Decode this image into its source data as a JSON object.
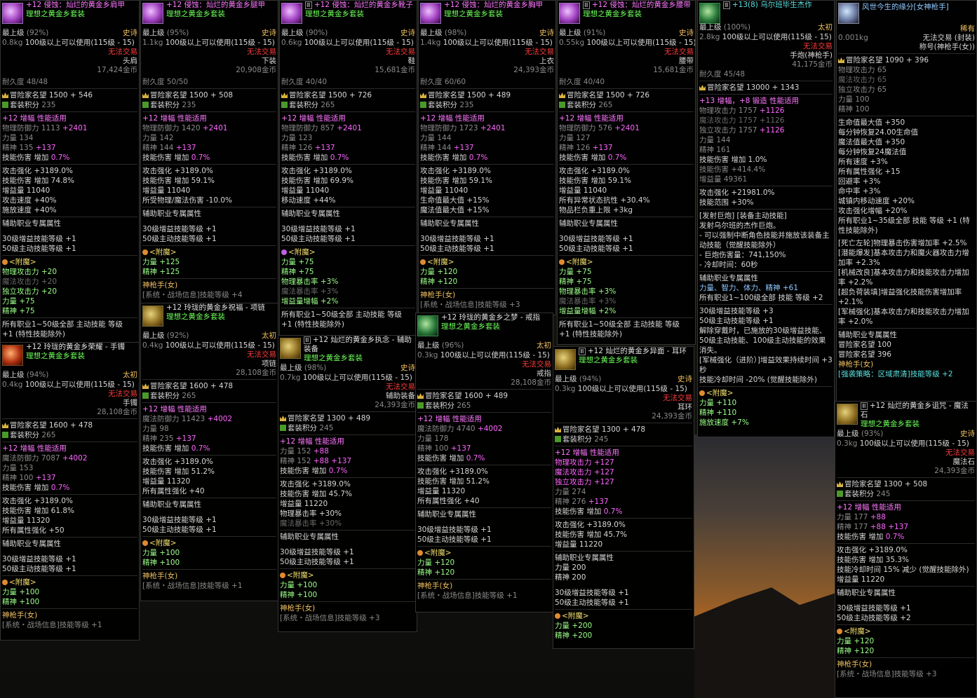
{
  "common": {
    "level_label": "最上级",
    "req_label": "100级以上可以使用(115级 - 15)",
    "no_trade": "无法交易",
    "set_name": "理想之黄金乡套装",
    "durability_prefix": "耐久度",
    "adv_prefix": "冒险家名望",
    "set_points_label": "套装积分",
    "perf_label": "增幅 性能适用",
    "aux_label": "辅助职业专属属性",
    "enchant_label": "<附魔>",
    "class": "神枪手(女)",
    "sys_line": "[系统・战场信息]技能等级",
    "lvl30": "30级增益技能等级 +1",
    "lvl50": "50级主动技能等级 +1",
    "skill_dmg": "技能伤害 增加",
    "atk_inc": "攻击强化 +3189.0%",
    "buff_label": "增益量"
  },
  "shoulder": {
    "title": "+12 侵蚀：灿烂的黄金乡肩甲",
    "grade_pct": "(92%)",
    "rarity": "史诗",
    "weight": "0.8kg",
    "slot": "头肩",
    "price": "17,424金币",
    "dura": "48/48",
    "adv": "1500 + 546",
    "set_pts": "235",
    "l1": "物理防御力 1113",
    "l1b": "+2401",
    "l2": "力量 134",
    "l3": "精神 135",
    "l3b": "+137",
    "l4b": "0.7%",
    "s1": "技能伤害 增加 74.8%",
    "s2": "增益量 11040",
    "s3": "攻击速度 +40%",
    "s4": "施放速度 +40%",
    "e1": "物理攻击力 +20",
    "e2": "魔法攻击力 +20",
    "e3": "独立攻击力 +20",
    "e4": "力量 +75",
    "e5": "精神 +75",
    "f1": "所有职业1~50级全部 主动技能 等级",
    "f2": "+1 (特性技能除外)"
  },
  "bracelet": {
    "title": "+12 玲珑的黄金乡荣耀 - 手镯",
    "grade_pct": "(94%)",
    "rarity": "太初",
    "weight": "0.4kg",
    "slot": "手镯",
    "price": "28,108金币",
    "adv": "1600 + 478",
    "set_pts": "265",
    "l1": "魔法防御力 7087",
    "l1b": "+4002",
    "l2": "力量 153",
    "l3": "精神 100",
    "l3b": "+137",
    "l4b": "0.7%",
    "s1": "技能伤害 增加 61.8%",
    "s2": "增益量 11320",
    "s3": "所有属性强化 +50",
    "e1": "力量 +100",
    "e2": "精神 +100",
    "sys": "+1"
  },
  "pants": {
    "title": "+12 侵蚀：灿烂的黄金乡腿甲",
    "grade_pct": "(95%)",
    "rarity": "史诗",
    "weight": "1.1kg",
    "slot": "下装",
    "price": "20,908金币",
    "dura": "50/50",
    "adv": "1500 + 508",
    "set_pts": "235",
    "l1": "物理防御力 1420",
    "l1b": "+2401",
    "l2": "力量 142",
    "l3": "精神 144",
    "l3b": "+137",
    "l4b": "0.7%",
    "s1": "技能伤害 增加 59.1%",
    "s2": "增益量 11040",
    "s3": "所受物理/魔法伤害 -10.0%",
    "e1": "力量 +125",
    "e2": "精神 +125",
    "sys": "+4"
  },
  "necklace": {
    "title": "+12 玲珑的黄金乡祝福 - 项链",
    "grade_pct": "(92%)",
    "rarity": "太初",
    "weight": "0.4kg",
    "slot": "项链",
    "price": "28,108金币",
    "adv": "1600 + 478",
    "set_pts": "265",
    "l1": "魔法防御力 11423",
    "l1b": "+4002",
    "l2": "力量 98",
    "l3": "精神 235",
    "l3b": "+137",
    "l4b": "0.7%",
    "s1": "技能伤害 增加 51.2%",
    "s2": "增益量 11320",
    "s3": "所有属性强化 +40",
    "e1": "力量 +100",
    "e2": "精神 +100",
    "sys": "+1"
  },
  "shoes": {
    "title": "+12 侵蚀：灿烂的黄金乡靴子",
    "grade_pct": "(90%)",
    "rarity": "史诗",
    "weight": "0.6kg",
    "slot": "鞋",
    "price": "15,681金币",
    "dura": "40/40",
    "adv": "1500 + 726",
    "set_pts": "265",
    "l1": "物理防御力 857",
    "l1b": "+2401",
    "l2": "力量 123",
    "l3": "精神 126",
    "l3b": "+137",
    "l4b": "0.7%",
    "s1": "技能伤害 增加 69.9%",
    "s2": "增益量 11040",
    "s3": "移动速度 +44%",
    "e1": "力量 +75",
    "e2": "精神 +75",
    "e3": "物理暴击率 +3%",
    "e4": "魔法暴击率 +3%",
    "e5": "增益量增幅 +2%",
    "f1": "所有职业1~50级全部 主动技能 等级",
    "f2": "+1 (特性技能除外)"
  },
  "aux": {
    "title": "+12 灿烂的黄金乡执念 - 辅助装备",
    "grade_pct": "(98%)",
    "rarity": "史诗",
    "weight": "0.7kg",
    "slot": "辅助装备",
    "price": "24,393金币",
    "adv": "1300 + 489",
    "set_pts": "245",
    "l2": "力量 152",
    "l2b": "+88",
    "l3": "精神 152",
    "l3b": "+88 +137",
    "l4b": "0.7%",
    "s1": "技能伤害 增加 45.7%",
    "s2": "增益量 11220",
    "s3": "物理暴击率 +30%",
    "s4": "魔法暴击率 +30%",
    "e1": "力量 +100",
    "e2": "精神 +100",
    "sys": "+3"
  },
  "chest": {
    "title": "+12 侵蚀：灿烂的黄金乡胸甲",
    "grade_pct": "(98%)",
    "rarity": "史诗",
    "weight": "1.4kg",
    "slot": "上衣",
    "price": "24,393金币",
    "dura": "60/60",
    "adv": "1500 + 489",
    "set_pts": "235",
    "l1": "物理防御力 1723",
    "l1b": "+2401",
    "l2": "力量 144",
    "l3": "精神 144",
    "l3b": "+137",
    "l4b": "0.7%",
    "s1": "技能伤害 增加 59.1%",
    "s2": "增益量 11040",
    "s3": "生命值最大值 +15%",
    "s4": "魔法值最大值 +15%",
    "e1": "力量 +120",
    "e2": "精神 +120",
    "sys": "+3"
  },
  "ring": {
    "title": "+12 玲珑的黄金乡之梦 - 戒指",
    "grade_pct": "(96%)",
    "rarity": "太初",
    "weight": "0.3kg",
    "slot": "戒指",
    "price": "28,108金币",
    "adv": "1600 + 489",
    "set_pts": "265",
    "l1": "魔法防御力 4740",
    "l1b": "+4002",
    "l2": "力量 178",
    "l3": "精神 100",
    "l3b": "+137",
    "l4b": "0.7%",
    "s1": "技能伤害 增加 51.2%",
    "s2": "增益量 11320",
    "s3": "所有属性强化 +40",
    "e1": "力量 +120",
    "e2": "精神 +120",
    "sys": "+1"
  },
  "belt": {
    "title": "+12 侵蚀：灿烂的黄金乡腰带",
    "grade_pct": "(91%)",
    "rarity": "史诗",
    "weight": "0.55kg",
    "slot": "腰带",
    "price": "15,681金币",
    "dura": "40/40",
    "adv": "1500 + 726",
    "set_pts": "265",
    "l1": "物理防御力 576",
    "l1b": "+2401",
    "l2": "力量 127",
    "l3": "精神 126",
    "l3b": "+137",
    "l4b": "0.7%",
    "s1": "技能伤害 增加 59.1%",
    "s2": "增益量 11040",
    "s3": "所有异常状态抗性 +30.4%",
    "s4": "物品栏负重上限 +3kg",
    "e1": "力量 +75",
    "e2": "精神 +75",
    "e3": "物理暴击率 +3%",
    "e4": "魔法暴击率 +3%",
    "e5": "增益量增幅 +2%",
    "f1": "所有职业1~50级全部 主动技能 等级",
    "f2": "+1 (特性技能除外)"
  },
  "earring": {
    "title": "+12 灿烂的黄金乡异面 - 耳环",
    "grade_pct": "(94%)",
    "rarity": "史诗",
    "weight": "0.3kg",
    "slot": "耳环",
    "price": "24,393金币",
    "adv": "1300 + 478",
    "set_pts": "245",
    "p1": "物理攻击力 +127",
    "p2": "魔法攻击力 +127",
    "p3": "独立攻击力 +127",
    "l2": "力量 274",
    "l3": "精神 276",
    "l3b": "+137",
    "l4b": "0.7%",
    "s1": "技能伤害 增加 45.7%",
    "s2": "增益量 11220",
    "a1": "力量 200",
    "a2": "精神 200",
    "e1": "力量 +200",
    "e2": "精神 +200"
  },
  "weapon": {
    "title": "+13(8) 乌尔班毕生杰作",
    "grade_pct": "(100%)",
    "rarity": "太初",
    "weight": "2.8kg",
    "slot": "手炮(神枪手)",
    "price": "41,175金币",
    "dura": "45/48",
    "adv": "13000 + 1343",
    "forge": "+13 增幅，+8 锻造 性能适用",
    "w1": "物理攻击力 1757",
    "w1b": "+1126",
    "w2": "魔法攻击力 1757",
    "w2b": "+1126",
    "w3": "独立攻击力 1757",
    "w3b": "+1126",
    "w4": "力量 144",
    "w5": "精神 161",
    "w6": "技能伤害 增加 1.0%",
    "w7": "技能伤害 +414.4%",
    "w8": "增益量 49361",
    "w9": "攻击强化 +21981.0%",
    "w10": "技能范围 +30%",
    "d1": "[发射巨炮] [装备主动技能]",
    "d2": "发射乌尔班的杰作巨炮。",
    "d3": "- 可以强制中断角色技能并施放该装备主动技能（觉醒技能除外）",
    "d4": "- 巨炮伤害量：741,150%",
    "d5": "- 冷却时间：60秒",
    "aux1": "力量、智力、体力、精神 +61",
    "aux2": "所有职业1~100级全部 技能 等级 +2",
    "x1": "30级增益技能等级 +3",
    "x2": "50级主动技能等级 +1",
    "x3": "解除穿戴时，已施放的30级增益技能、50级主动技能、100级主动技能的效果消失。",
    "x4": "[军械强化（进阶）]增益效果持续时间 +3秒",
    "x5": "技能冷却时间 -20% (觉醒技能除外)",
    "e1": "力量 +110",
    "e2": "精神 +110",
    "e3": "施放速度 +7%"
  },
  "title_item": {
    "title": "风世今生的缘分[女神枪手]",
    "rarity": "稀有",
    "weight": "0.001kg",
    "trade": "无法交易 (封装)",
    "slot": "称号(神枪手(女))",
    "adv": "1090 + 396",
    "t1": "物理攻击力 65",
    "t2": "魔法攻击力 65",
    "t3": "独立攻击力 65",
    "t4": "力量 100",
    "t5": "精神 100",
    "b1": "生命值最大值 +350",
    "b2": "每分钟恢复24.00生命值",
    "b3": "魔法值最大值 +350",
    "b4": "每分钟恢复24魔法值",
    "b5": "所有速度 +3%",
    "b6": "所有属性强化 +15",
    "b7": "回避率 +3%",
    "b8": "命中率 +3%",
    "b9": "城镇内移动速度 +20%",
    "b10": "攻击强化增幅 +20%",
    "b11": "所有职业1~35级全部 技能 等级 +1 (特性技能除外)",
    "c1": "[死亡左轮]物理暴击伤害增加率 +2.5%",
    "c2": "[潜能爆发]基本攻击力和魔火器攻击力增加率 +2.3%",
    "c3": "[机械改良]基本攻击力和技能攻击力增加率 +2.2%",
    "c4": "[超负荷装填]增益强化技能伤害增加率 +2.1%",
    "c5": "[军械强化]基本攻击力和技能攻击力增加率 +2.0%",
    "aux_adv": "冒险家名望 100",
    "adv2": "冒险家名望 396",
    "skill": "[强袭策略：区域肃清]技能等级 +2"
  },
  "stone": {
    "title": "+12 灿烂的黄金乡诅咒 - 魔法石",
    "grade_pct": "(93%)",
    "rarity": "史诗",
    "weight": "0.3kg",
    "slot": "魔法石",
    "price": "24,393金币",
    "adv": "1300 + 508",
    "set_pts": "245",
    "l2": "力量 177",
    "l2b": "+88",
    "l3": "精神 177",
    "l3b": "+88 +137",
    "l4b": "0.7%",
    "s1": "技能伤害 增加 35.3%",
    "s2": "技能冷却时间 15% 减少 (觉醒技能除外)",
    "s3": "增益量 11220",
    "x1": "30级增益技能等级 +1",
    "x2": "50级主动技能等级 +2",
    "e1": "力量 +120",
    "e2": "精神 +120",
    "sys": "+3"
  }
}
